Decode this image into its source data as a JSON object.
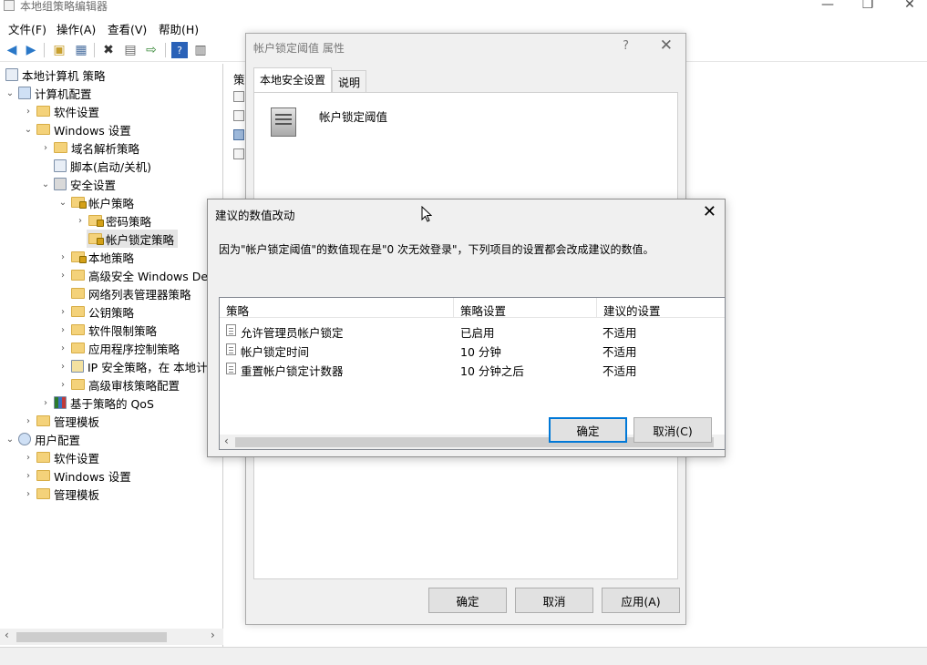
{
  "window": {
    "title": "本地组策略编辑器",
    "controls": {
      "minimize": "—",
      "maximize": "❐",
      "close": "✕"
    }
  },
  "menu": [
    "文件(F)",
    "操作(A)",
    "查看(V)",
    "帮助(H)"
  ],
  "tree": {
    "items": [
      {
        "label": "本地计算机 策略",
        "depth": 0,
        "icon": "policy-icon"
      },
      {
        "label": "计算机配置",
        "depth": 0,
        "icon": "computer-icon",
        "expanded": true
      },
      {
        "label": "软件设置",
        "depth": 1,
        "icon": "folder-icon"
      },
      {
        "label": "Windows 设置",
        "depth": 1,
        "icon": "folder-icon",
        "expanded": true
      },
      {
        "label": "域名解析策略",
        "depth": 2,
        "icon": "folder-icon"
      },
      {
        "label": "脚本(启动/关机)",
        "depth": 2,
        "icon": "script-icon"
      },
      {
        "label": "安全设置",
        "depth": 2,
        "icon": "security-icon",
        "expanded": true
      },
      {
        "label": "帐户策略",
        "depth": 3,
        "icon": "folder-lock-icon",
        "expanded": true
      },
      {
        "label": "密码策略",
        "depth": 4,
        "icon": "folder-lock-icon"
      },
      {
        "label": "帐户锁定策略",
        "depth": 4,
        "icon": "folder-lock-icon",
        "selected": true
      },
      {
        "label": "本地策略",
        "depth": 3,
        "icon": "folder-lock-icon"
      },
      {
        "label": "高级安全 Windows Def",
        "depth": 3,
        "icon": "folder-icon"
      },
      {
        "label": "网络列表管理器策略",
        "depth": 3,
        "icon": "folder-icon"
      },
      {
        "label": "公钥策略",
        "depth": 3,
        "icon": "folder-icon"
      },
      {
        "label": "软件限制策略",
        "depth": 3,
        "icon": "folder-icon"
      },
      {
        "label": "应用程序控制策略",
        "depth": 3,
        "icon": "folder-icon"
      },
      {
        "label": "IP 安全策略，在 本地计",
        "depth": 3,
        "icon": "ip-security-icon"
      },
      {
        "label": "高级审核策略配置",
        "depth": 3,
        "icon": "folder-icon"
      },
      {
        "label": "基于策略的 QoS",
        "depth": 2,
        "icon": "qos-icon"
      },
      {
        "label": "管理模板",
        "depth": 1,
        "icon": "folder-icon"
      },
      {
        "label": "用户配置",
        "depth": 0,
        "icon": "user-icon",
        "expanded": true
      },
      {
        "label": "软件设置",
        "depth": 1,
        "icon": "folder-icon"
      },
      {
        "label": "Windows 设置",
        "depth": 1,
        "icon": "folder-icon"
      },
      {
        "label": "管理模板",
        "depth": 1,
        "icon": "folder-icon"
      }
    ]
  },
  "right_pane": {
    "header": "策"
  },
  "properties": {
    "title": "帐户锁定阈值 属性",
    "help": "?",
    "tabs": [
      "本地安全设置",
      "说明"
    ],
    "policy_name": "帐户锁定阈值",
    "buttons": {
      "ok": "确定",
      "cancel": "取消",
      "apply": "应用(A)"
    }
  },
  "suggested": {
    "title": "建议的数值改动",
    "message": "因为\"帐户锁定阈值\"的数值现在是\"0 次无效登录\"，下列项目的设置都会改成建议的数值。",
    "columns": [
      "策略",
      "策略设置",
      "建议的设置"
    ],
    "rows": [
      {
        "policy": "允许管理员帐户锁定",
        "setting": "已启用",
        "suggested": "不适用"
      },
      {
        "policy": "帐户锁定时间",
        "setting": "10 分钟",
        "suggested": "不适用"
      },
      {
        "policy": "重置帐户锁定计数器",
        "setting": "10 分钟之后",
        "suggested": "不适用"
      }
    ],
    "buttons": {
      "ok": "确定",
      "cancel": "取消(C)"
    }
  }
}
